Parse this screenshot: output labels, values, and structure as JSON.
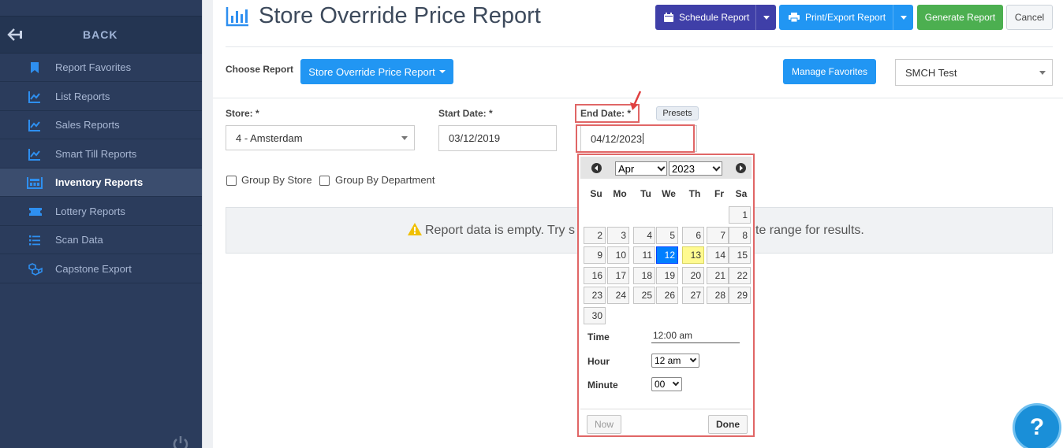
{
  "sidebar": {
    "back_label": "BACK",
    "items": [
      {
        "label": "Report Favorites",
        "icon": "bookmark-icon"
      },
      {
        "label": "List Reports",
        "icon": "line-chart-icon"
      },
      {
        "label": "Sales Reports",
        "icon": "line-chart-icon"
      },
      {
        "label": "Smart Till Reports",
        "icon": "line-chart-icon"
      },
      {
        "label": "Inventory Reports",
        "icon": "inventory-icon",
        "active": true
      },
      {
        "label": "Lottery Reports",
        "icon": "ticket-icon"
      },
      {
        "label": "Scan Data",
        "icon": "list-icon"
      },
      {
        "label": "Capstone Export",
        "icon": "boxes-icon"
      }
    ]
  },
  "header": {
    "title": "Store Override Price Report",
    "schedule_label": "Schedule Report",
    "print_label": "Print/Export Report",
    "generate_label": "Generate Report",
    "cancel_label": "Cancel"
  },
  "report_bar": {
    "choose_label": "Choose Report",
    "report_button": "Store Override Price Report",
    "manage_favorites": "Manage Favorites",
    "account_select": "SMCH Test"
  },
  "filters": {
    "store_label": "Store: *",
    "store_value": "4 - Amsterdam",
    "start_label": "Start Date: *",
    "start_value": "03/12/2019",
    "end_label": "End Date: *",
    "end_value": "04/12/2023",
    "presets_label": "Presets",
    "group_store": "Group By Store",
    "group_department": "Group By Department"
  },
  "empty_message": {
    "left": "Report data is empty. Try s",
    "right": "te range for results."
  },
  "datepicker": {
    "month": "Apr",
    "year": "2023",
    "weekdays": [
      "Su",
      "Mo",
      "Tu",
      "We",
      "Th",
      "Fr",
      "Sa"
    ],
    "days": [
      "1",
      "2",
      "3",
      "4",
      "5",
      "6",
      "7",
      "8",
      "9",
      "10",
      "11",
      "12",
      "13",
      "14",
      "15",
      "16",
      "17",
      "18",
      "19",
      "20",
      "21",
      "22",
      "23",
      "24",
      "25",
      "26",
      "27",
      "28",
      "29",
      "30"
    ],
    "selected_day": "12",
    "today_day": "13",
    "time_label": "Time",
    "time_value": "12:00 am",
    "hour_label": "Hour",
    "hour_value": "12 am",
    "minute_label": "Minute",
    "minute_value": "00",
    "now_label": "Now",
    "done_label": "Done"
  },
  "help_label": "?",
  "colors": {
    "sidebar": "#2b3c5c",
    "schedule_button": "#3f3fa8",
    "primary_button": "#2196f3",
    "generate_button": "#4caf50",
    "highlight_frame": "#e06666",
    "selected_day": "#007fff",
    "today_day": "#fffa90"
  }
}
